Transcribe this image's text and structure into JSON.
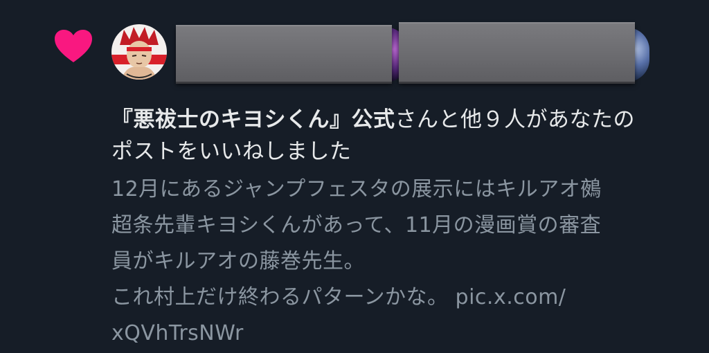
{
  "notification": {
    "type_icon": "heart-icon",
    "accent_color": "#f91880",
    "background_color": "#161d27",
    "headline": {
      "account_name": "『悪祓士のキヨシくん』公式",
      "line1_rest": "さんと他９人があなたの",
      "line2": "ポストをいいねしました"
    },
    "tweet": {
      "lines": [
        "12月にあるジャンプフェスタの展示にはキルアオ鵺",
        "超条先輩キヨシくんがあって、11月の漫画賞の審査",
        "員がキルアオの藤巻先生。",
        "これ村上だけ終わるパターンかな。 pic.x.com/",
        "xQVhTrsNWr"
      ]
    }
  }
}
